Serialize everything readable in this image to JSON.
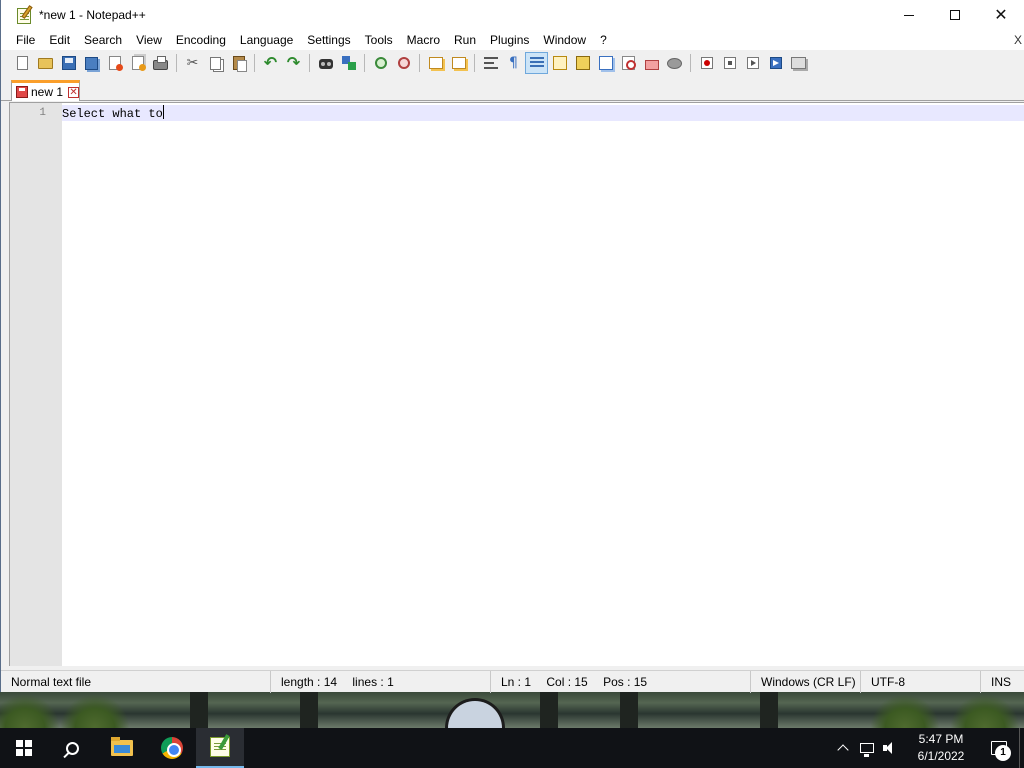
{
  "window": {
    "title": "*new 1 - Notepad++"
  },
  "menu": {
    "items": [
      "File",
      "Edit",
      "Search",
      "View",
      "Encoding",
      "Language",
      "Settings",
      "Tools",
      "Macro",
      "Run",
      "Plugins",
      "Window",
      "?"
    ],
    "close_glyph": "X"
  },
  "toolbar": {
    "icons": [
      "new-file-icon",
      "open-file-icon",
      "save-icon",
      "save-all-icon",
      "close-icon",
      "close-all-icon",
      "print-icon",
      "cut-icon",
      "copy-icon",
      "paste-icon",
      "undo-icon",
      "redo-icon",
      "find-icon",
      "replace-icon",
      "zoom-in-icon",
      "zoom-out-icon",
      "sync-vertical-icon",
      "sync-horizontal-icon",
      "word-wrap-icon",
      "show-all-characters-icon",
      "indent-guide-icon",
      "user-defined-language-icon",
      "document-map-icon",
      "document-list-icon",
      "function-list-icon",
      "folder-as-workspace-icon",
      "monitoring-icon",
      "start-recording-icon",
      "stop-recording-icon",
      "playback-icon",
      "run-macro-multiple-icon",
      "save-macro-icon"
    ],
    "active_icon": "indent-guide-icon"
  },
  "tabs": [
    {
      "label": "new 1",
      "active": true,
      "modified": true
    }
  ],
  "editor": {
    "lines": [
      {
        "number": "1",
        "text": "Select what to"
      }
    ],
    "current_line_color": "#e8e8ff"
  },
  "status": {
    "file_type": "Normal text file",
    "length": "length : 14",
    "lines": "lines : 1",
    "ln": "Ln : 1",
    "col": "Col : 15",
    "pos": "Pos : 15",
    "eol": "Windows (CR LF)",
    "encoding": "UTF-8",
    "mode": "INS"
  },
  "taskbar": {
    "apps": [
      "search-icon",
      "file-explorer-icon",
      "chrome-icon",
      "notepad-plus-plus-icon"
    ],
    "running_app": "notepad-plus-plus-icon",
    "time": "5:47 PM",
    "date": "6/1/2022",
    "notification_count": "1"
  },
  "colors": {
    "tab_accent": "#fa9e2a",
    "taskbar_bg": "#101216",
    "taskbar_indicator": "#76b9ed"
  }
}
